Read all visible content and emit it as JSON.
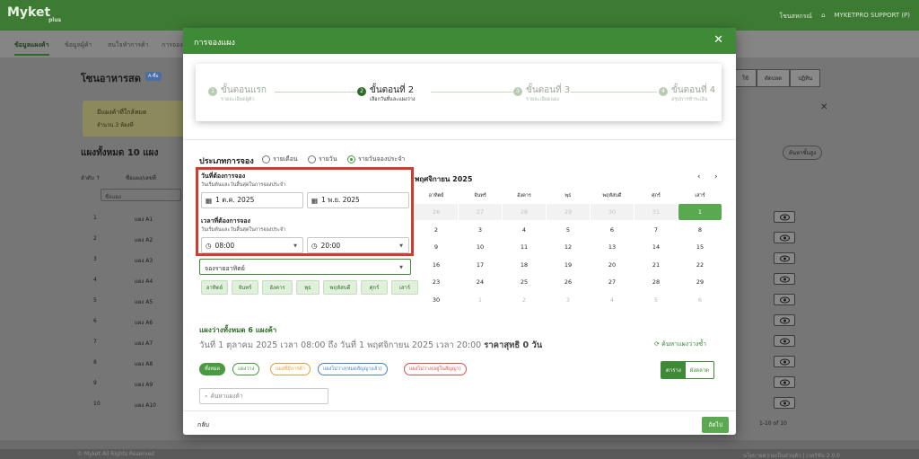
{
  "app": {
    "logo": "Myket",
    "logo_sub": "plus",
    "top_right": {
      "news": "โชนสหกรณ์",
      "user": "MYKETPRO SUPPORT (P)"
    },
    "nav_tabs": [
      "ข้อมูลแผงค้า",
      "ข้อมูลผู้ค้า",
      "สนใจทำการค้า",
      "การจอง"
    ],
    "bg_title": "โซนอาหารสด",
    "bg_badge": "A-ซื้อ",
    "bg_banner_title": "มีแผงค้าที่ใกล้หมด",
    "bg_banner_count": "จำนวน 3 ห้องที่",
    "bg_count": "แผงทั้งหมด 10 แผง",
    "bg_col_order": "ลำดับ ↑",
    "bg_col_zone": "ชื่อแผง/เลขที่",
    "bg_filter": "ชื่อแผง",
    "bg_right_btns": [
      "ใช้",
      "ตัดปลด",
      "ปฏิทิน"
    ],
    "bg_pill": "ค้นหาขั้นสูง",
    "bg_rows": [
      {
        "n": "1",
        "z": "แผง A1"
      },
      {
        "n": "2",
        "z": "แผง A2"
      },
      {
        "n": "3",
        "z": "แผง A3"
      },
      {
        "n": "4",
        "z": "แผง A4"
      },
      {
        "n": "5",
        "z": "แผง A5"
      },
      {
        "n": "6",
        "z": "แผง A6"
      },
      {
        "n": "7",
        "z": "แผง A7"
      },
      {
        "n": "8",
        "z": "แผง A8"
      },
      {
        "n": "9",
        "z": "แผง A9"
      },
      {
        "n": "10",
        "z": "แผง A10"
      }
    ],
    "bg_pager": "1-10 of 10",
    "footer_left": "© Myket All Rights Reserved",
    "footer_right": "นโยบายความเป็นส่วนตัว | เวอร์ชัน 2.0.0"
  },
  "modal": {
    "title": "การจองแผง",
    "steps": [
      {
        "num": "1",
        "title": "ขั้นตอนแรก",
        "sub": "รายละเอียดผู้ค้า"
      },
      {
        "num": "2",
        "title": "ขั้นตอนที่ 2",
        "sub": "เลือกวันที่และแผงว่าง"
      },
      {
        "num": "3",
        "title": "ขั้นตอนที่ 3",
        "sub": "รายละเอียดแผง"
      },
      {
        "num": "4",
        "title": "ขั้นตอนที่ 4",
        "sub": "สรุปการชำระเงิน"
      }
    ],
    "booking_type_label": "ประเภทการจอง",
    "booking_options": [
      "รายเดือน",
      "รายวัน",
      "รายวันจองประจำ"
    ],
    "date_label": "วันที่ต้องการจอง",
    "date_sub": "วันเริ่มต้นและวันสิ้นสุดในการจองประจำ",
    "start_date": "1 ต.ค. 2025",
    "end_date": "1 พ.ย. 2025",
    "time_label": "เวลาที่ต้องการจอง",
    "time_sub": "วันเริ่มต้นและวันสิ้นสุดในการจองประจำ",
    "start_time": "08:00",
    "end_time": "20:00",
    "weekly_dropdown": "จองรายอาทิตย์",
    "days": [
      "อาทิตย์",
      "จันทร์",
      "อังคาร",
      "พุธ",
      "พฤหัสบดี",
      "ศุกร์",
      "เสาร์"
    ],
    "calendar_title": "พฤศจิกายน 2025",
    "calendar_prev": "‹",
    "calendar_next": "›",
    "calendar_headers": [
      "อาทิตย์",
      "จันทร์",
      "อังคาร",
      "พุธ",
      "พฤหัสบดี",
      "ศุกร์",
      "เสาร์"
    ],
    "calendar_rows": [
      [
        "26",
        "27",
        "28",
        "29",
        "30",
        "31",
        "1"
      ],
      [
        "2",
        "3",
        "4",
        "5",
        "6",
        "7",
        "8"
      ],
      [
        "9",
        "10",
        "11",
        "12",
        "13",
        "14",
        "15"
      ],
      [
        "16",
        "17",
        "18",
        "19",
        "20",
        "21",
        "22"
      ],
      [
        "23",
        "24",
        "25",
        "26",
        "27",
        "28",
        "29"
      ],
      [
        "30",
        "1",
        "2",
        "3",
        "4",
        "5",
        "6"
      ]
    ],
    "available_title": "แผงว่างทั้งหมด 6 แผงค้า",
    "available_desc": "วันที่ 1 ตุลาคม 2025 เวลา 08:00 ถึง วันที่ 1 พฤศจิกายน 2025 เวลา 20:00",
    "available_price": "ราคาสุทธิ 0 วัน",
    "refresh_label": "ค้นหาแผงว่างซ้ำ",
    "chips": [
      {
        "label": "ทั้งหมด",
        "color": "#4a9a3f",
        "bg": "#4a9a3f",
        "fg": "#ffffff"
      },
      {
        "label": "แผงว่าง",
        "color": "#4a9a3f",
        "bg": "#ffffff",
        "fg": "#4a9a3f"
      },
      {
        "label": "แผงที่มีการค้า",
        "color": "#e0a23a",
        "bg": "#ffffff",
        "fg": "#e0a23a"
      },
      {
        "label": "แผงไม่ว่าง(หมดสัญญาแล้ว)",
        "color": "#4a84c4",
        "bg": "#ffffff",
        "fg": "#4a84c4"
      },
      {
        "label": "แผงไม่ว่าง(อยู่ในสัญญา)",
        "color": "#d9534f",
        "bg": "#ffffff",
        "fg": "#d9534f"
      }
    ],
    "view_toggle": [
      "ตาราง",
      "ผังตลาด"
    ],
    "search_placeholder": "ค้นหาแผงค้า",
    "back_label": "กลับ",
    "next_label": "ถัดไป"
  }
}
